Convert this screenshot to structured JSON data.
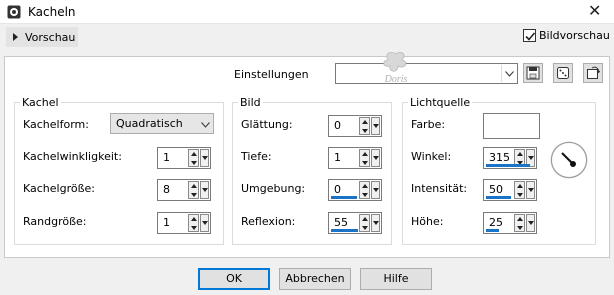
{
  "window": {
    "title": "Kacheln",
    "close_symbol": "✕"
  },
  "preview": {
    "toggle_label": "Vorschau",
    "checkbox_label": "Bildvorschau",
    "checked": true
  },
  "settings": {
    "label": "Einstellungen",
    "value": "",
    "watermark_text": "Doris"
  },
  "kachel": {
    "title": "Kachel",
    "form_label": "Kachelform:",
    "form_value": "Quadratisch",
    "angle_label": "Kachelwinkligkeit:",
    "angle_value": "1",
    "size_label": "Kachelgröße:",
    "size_value": "8",
    "border_label": "Randgröße:",
    "border_value": "1"
  },
  "bild": {
    "title": "Bild",
    "smooth_label": "Glättung:",
    "smooth_value": "0",
    "depth_label": "Tiefe:",
    "depth_value": "1",
    "ambient_label": "Umgebung:",
    "ambient_value": "0",
    "reflection_label": "Reflexion:",
    "reflection_value": "55"
  },
  "licht": {
    "title": "Lichtquelle",
    "color_label": "Farbe:",
    "color_value": "#ffffff",
    "angle_label": "Winkel:",
    "angle_value": "315",
    "intensity_label": "Intensität:",
    "intensity_value": "50",
    "height_label": "Höhe:",
    "height_value": "25"
  },
  "buttons": {
    "ok": "OK",
    "cancel": "Abbrechen",
    "help": "Hilfe"
  },
  "colors": {
    "accent": "#1a73c8",
    "focus": "#0078d7"
  }
}
